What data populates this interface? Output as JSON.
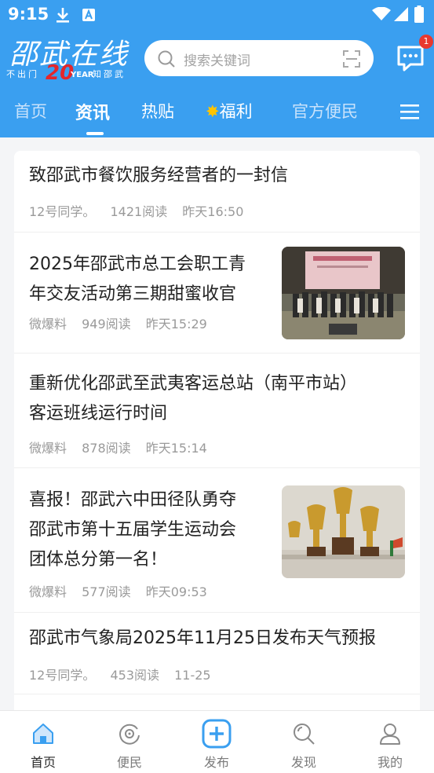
{
  "status_bar": {
    "time": "9:15"
  },
  "logo": {
    "main": "邵武在线",
    "sub_left": "不出门",
    "anniversary": "20",
    "year_text": "YEAR",
    "sub_right": "知邵武"
  },
  "search": {
    "placeholder": "搜索关键词"
  },
  "messages": {
    "badge": "1"
  },
  "tabs": [
    {
      "label": "首页"
    },
    {
      "label": "资讯"
    },
    {
      "label": "热贴"
    },
    {
      "label": "福利"
    },
    {
      "label": "官方便民"
    }
  ],
  "articles": [
    {
      "title_lines": [
        "致邵武市餐饮服务经营者的一封信"
      ],
      "author": "12号同学。",
      "reads": "1421阅读",
      "time": "昨天16:50"
    },
    {
      "title_lines": [
        "2025年邵武市总工会职工青",
        "年交友活动第三期甜蜜收官"
      ],
      "author": "微爆料",
      "reads": "949阅读",
      "time": "昨天15:29"
    },
    {
      "title_lines": [
        "重新优化邵武至武夷客运总站（南平市站）",
        "客运班线运行时间"
      ],
      "author": "微爆料",
      "reads": "878阅读",
      "time": "昨天15:14"
    },
    {
      "title_lines": [
        "喜报！邵武六中田径队勇夺",
        "邵武市第十五届学生运动会",
        "团体总分第一名！"
      ],
      "author": "微爆料",
      "reads": "577阅读",
      "time": "昨天09:53"
    },
    {
      "title_lines": [
        "邵武市气象局2025年11月25日发布天气预报"
      ],
      "author": "12号同学。",
      "reads": "453阅读",
      "time": "11-25"
    }
  ],
  "bottom_nav": [
    {
      "label": "首页"
    },
    {
      "label": "便民"
    },
    {
      "label": "发布"
    },
    {
      "label": "发现"
    },
    {
      "label": "我的"
    }
  ],
  "colors": {
    "brand": "#3a9ff0",
    "badge": "#e8382f",
    "active_icon": "#3a9ff0"
  }
}
